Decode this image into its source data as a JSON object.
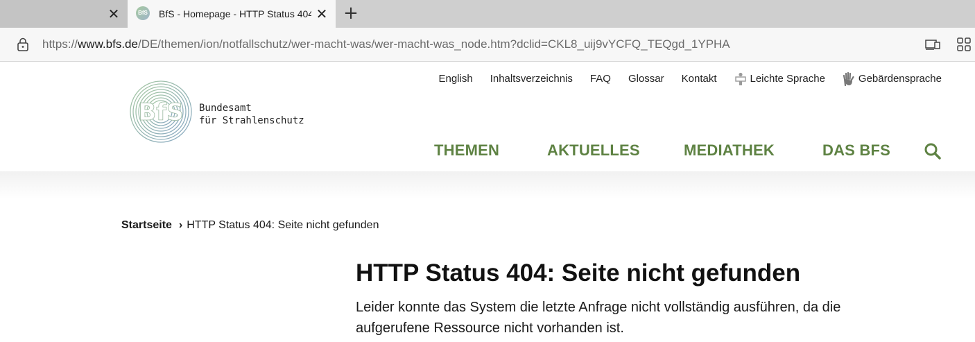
{
  "browser": {
    "tabs": [
      {
        "title": "",
        "active": false,
        "close_label": "✕"
      },
      {
        "title": "BfS - Homepage - HTTP Status 404",
        "active": true,
        "favicon_text": "BfS",
        "close_label": "✕"
      }
    ],
    "new_tab_label": "+",
    "address": {
      "scheme": "https://",
      "host": "www.bfs.de",
      "path": "/DE/themen/ion/notfallschutz/wer-macht-was/wer-macht-was_node.htm?dclid=CKL8_uij9vYCFQ_TEQgd_1YPHA"
    },
    "icons": [
      "lock-icon",
      "reader-view-icon",
      "apps-icon"
    ]
  },
  "site": {
    "logo_lines": [
      "Bundesamt",
      "für Strahlenschutz"
    ],
    "service_nav": [
      {
        "label": "English",
        "icon": null
      },
      {
        "label": "Inhaltsverzeichnis",
        "icon": null
      },
      {
        "label": "FAQ",
        "icon": null
      },
      {
        "label": "Glossar",
        "icon": null
      },
      {
        "label": "Kontakt",
        "icon": null
      },
      {
        "label": "Leichte Sprache",
        "icon": "easy-language-icon"
      },
      {
        "label": "Gebärdensprache",
        "icon": "sign-language-icon"
      }
    ],
    "main_nav": [
      "THEMEN",
      "AKTUELLES",
      "MEDIATHEK",
      "DAS BFS"
    ],
    "accent_color": "#5e8243"
  },
  "breadcrumb": {
    "home": "Startseite",
    "separator": "›",
    "current": "HTTP Status 404: Seite nicht gefunden"
  },
  "content": {
    "title": "HTTP Status 404: Seite nicht gefunden",
    "text": "Leider konnte das System die letzte Anfrage nicht vollständig ausführen, da die aufgerufene Ressource nicht vorhanden ist."
  }
}
